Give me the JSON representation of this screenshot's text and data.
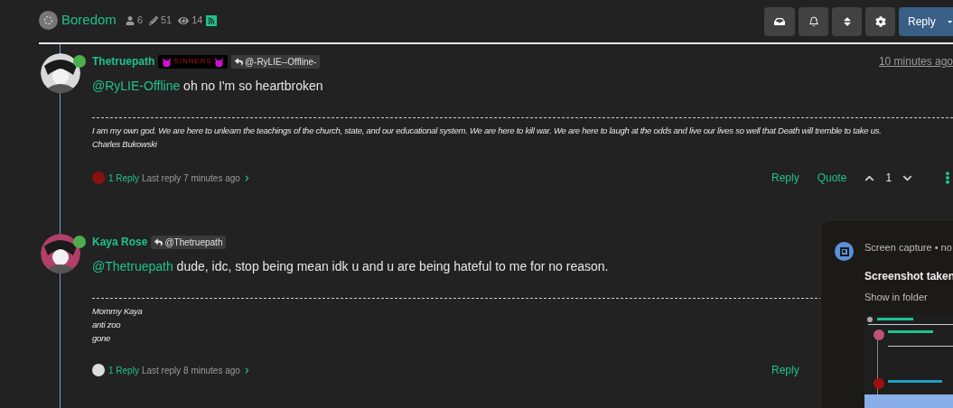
{
  "topic": {
    "title": "Boredom",
    "posters": "6",
    "posts": "51",
    "views": "14"
  },
  "toolbar": {
    "reply_label": "Reply"
  },
  "posts": [
    {
      "author": "Thetruepath",
      "online": true,
      "badge": {
        "kind": "group",
        "label": "SINNERS"
      },
      "reply_to": "@-RyLIE--Offline-",
      "time": "10 minutes ago",
      "mention": "@RyLIE-Offline",
      "body": " oh no I'm so heartbroken",
      "signature": [
        "I am my own god. We are here to unlearn the teachings of the church, state, and our educational system. We are here to kill war. We are here to laugh at the odds and live our lives so well that Death will tremble to take us.",
        "Charles Bukowski"
      ],
      "replies": "1 Reply",
      "last_reply": "Last reply 7 minutes ago",
      "actions": [
        "Reply",
        "Quote"
      ],
      "votes": "1"
    },
    {
      "author": "Kaya Rose",
      "online": true,
      "reply_to": "@Thetruepath",
      "mention": "@Thetruepath",
      "body": " dude, idc, stop being mean idk u and u are being hateful to me for no reason.",
      "signature": [
        "Mommy Kaya",
        "anti zoo",
        "gone"
      ],
      "replies": "1 Reply",
      "last_reply": "Last reply 8 minutes ago",
      "actions": [
        "Reply"
      ]
    }
  ],
  "notification": {
    "app": "Screen capture • no",
    "title": "Screenshot taken",
    "action": "Show in folder"
  }
}
